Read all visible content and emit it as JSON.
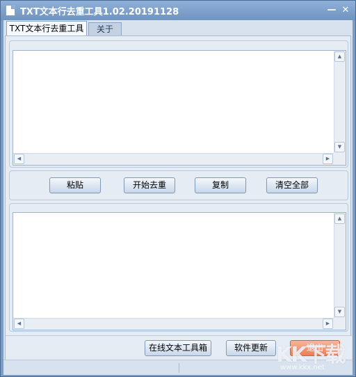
{
  "window": {
    "title": "TXT文本行去重工具1.02.20191128",
    "minimize_glyph": "—",
    "close_glyph": "✕"
  },
  "tabs": [
    {
      "label": "TXT文本行去重工具",
      "active": true
    },
    {
      "label": "关于",
      "active": false
    }
  ],
  "input_area": {
    "value": ""
  },
  "output_area": {
    "value": ""
  },
  "actions": {
    "paste": "粘贴",
    "dedupe": "开始去重",
    "copy": "复制",
    "clear": "清空全部"
  },
  "footer": {
    "toolbox": "在线文本工具箱",
    "update": "软件更新",
    "exit": "退出"
  },
  "icons": {
    "scroll_up": "▲",
    "scroll_down": "▼",
    "scroll_left": "◀",
    "scroll_right": "▶"
  },
  "watermark": {
    "logo": "KK下载",
    "url": "www.kkx.net"
  },
  "colors": {
    "titlebar": "#7d9cc3",
    "exit_button": "#ec7d55"
  }
}
